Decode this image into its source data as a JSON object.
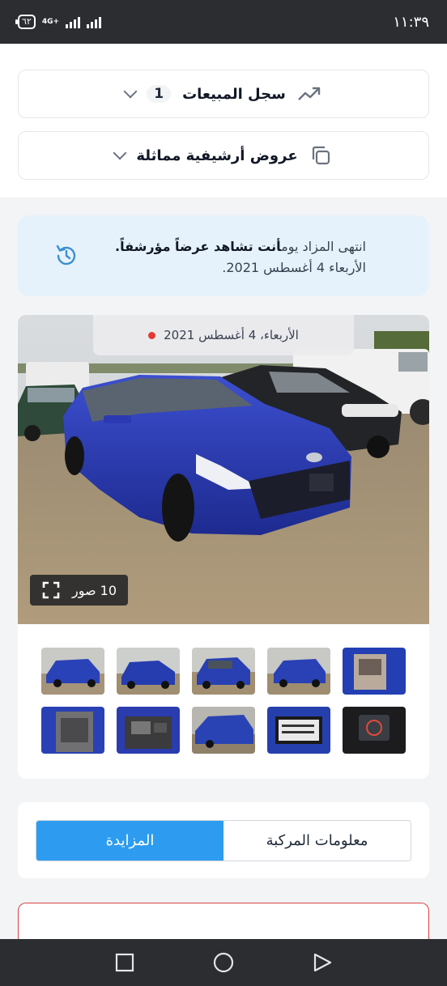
{
  "status_bar": {
    "time": "١١:٣٩",
    "battery": "٦٢",
    "network": "4G+"
  },
  "accordions": {
    "sales_history": {
      "title": "سجل المبيعات",
      "count": "1",
      "icon": "trending-up-icon"
    },
    "similar_archive": {
      "title": "عروض أرشيفية مماثلة",
      "icon": "copy-icon"
    }
  },
  "notice": {
    "text_prefix": "انتهى المزاد يوم",
    "text_bold": "أنت تشاهد عرضاً مؤرشفاً.",
    "date_line": "الأربعاء 4 أغسطس 2021.",
    "icon": "history-icon"
  },
  "gallery": {
    "date_label": "الأربعاء، 4 أغسطس 2021",
    "photo_count_label": "10 صور",
    "thumbnails": [
      "interior-front-seats",
      "rear-three-quarter",
      "front-three-quarter-low",
      "front-three-quarter",
      "front-three-quarter-angle",
      "dashboard-instrument-cluster",
      "vin-label",
      "rear-damage",
      "engine-bay",
      "rear-seats"
    ]
  },
  "tabs": {
    "vehicle_info": "معلومات المركبة",
    "auction": "المزايدة"
  },
  "colors": {
    "accent": "#2d9cf0",
    "notice_bg": "#e6f2fb",
    "alert_border": "#d94141"
  }
}
